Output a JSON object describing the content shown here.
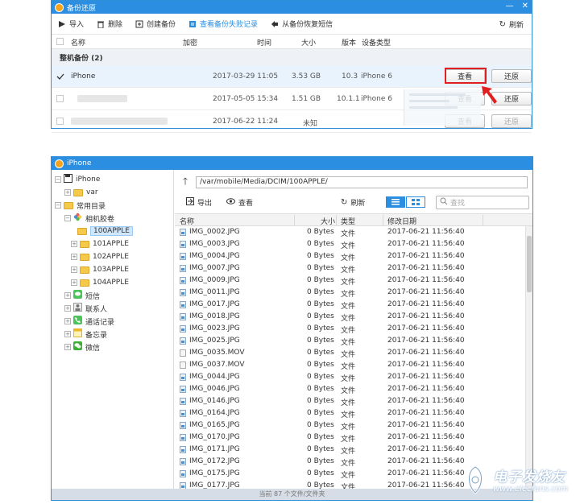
{
  "win1": {
    "title": "备份还原",
    "controls": {
      "minimize": "—",
      "close": "✕"
    },
    "toolbar": {
      "import": "导入",
      "delete": "删除",
      "create_backup": "创建备份",
      "view_failed": "查看备份失败记录",
      "restore_sms": "从备份恢复短信",
      "refresh": "刷新"
    },
    "columns": {
      "name": "名称",
      "encrypt": "加密",
      "time": "时间",
      "size": "大小",
      "version": "版本",
      "device_type": "设备类型"
    },
    "group_label": "整机备份 (2)",
    "rows": [
      {
        "name": "iPhone",
        "time": "2017-03-29 11:05",
        "size": "3.53 GB",
        "version": "10.3",
        "device": "iPhone 6",
        "view": "查看",
        "restore": "还原"
      },
      {
        "name": "",
        "time": "2017-05-05 15:34",
        "size": "1.51 GB",
        "version": "10.1.1",
        "device": "iPhone 6",
        "view": "查看",
        "restore": "还原"
      },
      {
        "name": "",
        "time": "2017-06-22 11:24",
        "size": "未知",
        "version": "",
        "device": "",
        "view": "查看",
        "restore": "还原"
      }
    ],
    "accent_color": "#2b8ee0",
    "highlight_color": "#e02020"
  },
  "win2": {
    "title": "iPhone",
    "tree": {
      "device": "iPhone",
      "var": "var",
      "common": "常用目录",
      "camera_roll": "相机胶卷",
      "folders": [
        "100APPLE",
        "101APPLE",
        "102APPLE",
        "103APPLE",
        "104APPLE"
      ],
      "sms": "短信",
      "contacts": "联系人",
      "call_log": "通话记录",
      "notes": "备忘录",
      "wechat": "微信"
    },
    "path": "/var/mobile/Media/DCIM/100APPLE/",
    "toolbar": {
      "export": "导出",
      "view": "查看",
      "refresh": "刷新",
      "search_placeholder": "查找"
    },
    "columns": {
      "name": "名称",
      "size": "大小",
      "type": "类型",
      "modified": "修改日期"
    },
    "files": [
      {
        "name": "IMG_0002.JPG",
        "size": "0 Bytes",
        "type": "文件",
        "date": "2017-06-21 11:56:40",
        "kind": "img"
      },
      {
        "name": "IMG_0003.JPG",
        "size": "0 Bytes",
        "type": "文件",
        "date": "2017-06-21 11:56:40",
        "kind": "img"
      },
      {
        "name": "IMG_0004.JPG",
        "size": "0 Bytes",
        "type": "文件",
        "date": "2017-06-21 11:56:40",
        "kind": "img"
      },
      {
        "name": "IMG_0007.JPG",
        "size": "0 Bytes",
        "type": "文件",
        "date": "2017-06-21 11:56:40",
        "kind": "img"
      },
      {
        "name": "IMG_0009.JPG",
        "size": "0 Bytes",
        "type": "文件",
        "date": "2017-06-21 11:56:40",
        "kind": "img"
      },
      {
        "name": "IMG_0011.JPG",
        "size": "0 Bytes",
        "type": "文件",
        "date": "2017-06-21 11:56:40",
        "kind": "img"
      },
      {
        "name": "IMG_0017.JPG",
        "size": "0 Bytes",
        "type": "文件",
        "date": "2017-06-21 11:56:40",
        "kind": "img"
      },
      {
        "name": "IMG_0018.JPG",
        "size": "0 Bytes",
        "type": "文件",
        "date": "2017-06-21 11:56:40",
        "kind": "img"
      },
      {
        "name": "IMG_0023.JPG",
        "size": "0 Bytes",
        "type": "文件",
        "date": "2017-06-21 11:56:40",
        "kind": "img"
      },
      {
        "name": "IMG_0025.JPG",
        "size": "0 Bytes",
        "type": "文件",
        "date": "2017-06-21 11:56:40",
        "kind": "img"
      },
      {
        "name": "IMG_0035.MOV",
        "size": "0 Bytes",
        "type": "文件",
        "date": "2017-06-21 11:56:40",
        "kind": "mov"
      },
      {
        "name": "IMG_0037.MOV",
        "size": "0 Bytes",
        "type": "文件",
        "date": "2017-06-21 11:56:40",
        "kind": "mov"
      },
      {
        "name": "IMG_0044.JPG",
        "size": "0 Bytes",
        "type": "文件",
        "date": "2017-06-21 11:56:40",
        "kind": "img"
      },
      {
        "name": "IMG_0046.JPG",
        "size": "0 Bytes",
        "type": "文件",
        "date": "2017-06-21 11:56:40",
        "kind": "img"
      },
      {
        "name": "IMG_0146.JPG",
        "size": "0 Bytes",
        "type": "文件",
        "date": "2017-06-21 11:56:40",
        "kind": "img"
      },
      {
        "name": "IMG_0164.JPG",
        "size": "0 Bytes",
        "type": "文件",
        "date": "2017-06-21 11:56:40",
        "kind": "img"
      },
      {
        "name": "IMG_0165.JPG",
        "size": "0 Bytes",
        "type": "文件",
        "date": "2017-06-21 11:56:40",
        "kind": "img"
      },
      {
        "name": "IMG_0170.JPG",
        "size": "0 Bytes",
        "type": "文件",
        "date": "2017-06-21 11:56:40",
        "kind": "img"
      },
      {
        "name": "IMG_0171.JPG",
        "size": "0 Bytes",
        "type": "文件",
        "date": "2017-06-21 11:56:40",
        "kind": "img"
      },
      {
        "name": "IMG_0172.JPG",
        "size": "0 Bytes",
        "type": "文件",
        "date": "2017-06-21 11:56:40",
        "kind": "img"
      },
      {
        "name": "IMG_0175.JPG",
        "size": "0 Bytes",
        "type": "文件",
        "date": "2017-06-21 11:56:40",
        "kind": "img"
      },
      {
        "name": "IMG_0177.JPG",
        "size": "0 Bytes",
        "type": "文件",
        "date": "2017-06-21 11:56:40",
        "kind": "img"
      }
    ],
    "status": "当前 87 个文件/文件夹"
  },
  "watermark": {
    "cn": "电子发烧友",
    "en": "www.elecfans.com"
  }
}
